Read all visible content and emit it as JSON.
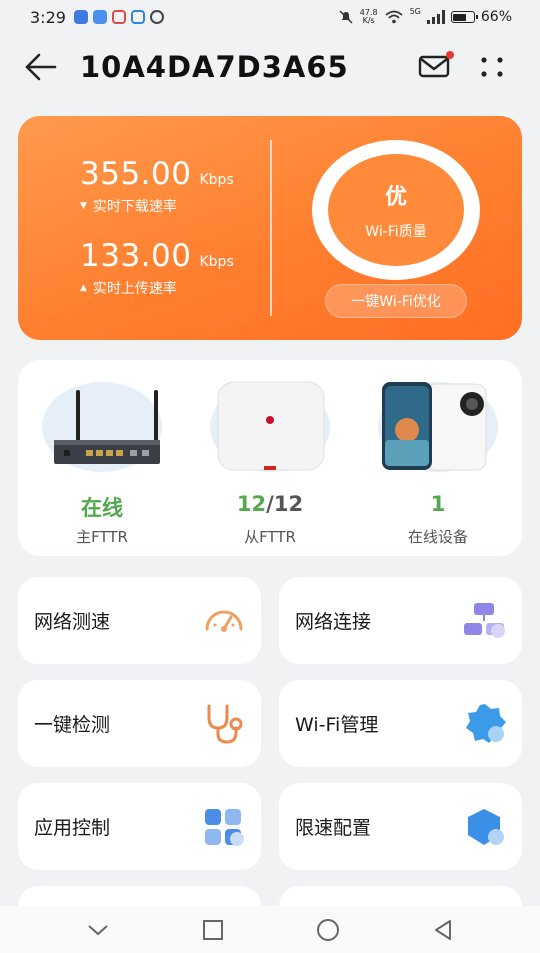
{
  "status_bar": {
    "time": "3:29",
    "net_speed_value": "47.8",
    "net_speed_unit": "K/s",
    "network": "5G",
    "battery": "66%",
    "battery_level": 0.66
  },
  "header": {
    "title": "10A4DA7D3A65"
  },
  "speed_card": {
    "download_value": "355.00",
    "download_unit": "Kbps",
    "download_label": "实时下载速率",
    "upload_value": "133.00",
    "upload_unit": "Kbps",
    "upload_label": "实时上传速率",
    "quality_grade": "优",
    "quality_label": "Wi-Fi质量",
    "optimize_label": "一键Wi-Fi优化",
    "colors": {
      "gradient_start": "#ff9a4d",
      "gradient_end": "#ff6f24"
    }
  },
  "devices": [
    {
      "status": "在线",
      "label": "主FTTR",
      "icon": "router-icon"
    },
    {
      "status_primary": "12",
      "status_rest": "/12",
      "label": "从FTTR",
      "icon": "access-point-icon"
    },
    {
      "status": "1",
      "label": "在线设备",
      "icon": "phone-icon"
    }
  ],
  "tiles": [
    {
      "label": "网络测速",
      "icon": "speedometer-icon"
    },
    {
      "label": "网络连接",
      "icon": "network-topology-icon"
    },
    {
      "label": "一键检测",
      "icon": "stethoscope-icon"
    },
    {
      "label": "Wi-Fi管理",
      "icon": "wifi-settings-icon"
    },
    {
      "label": "应用控制",
      "icon": "app-grid-icon"
    },
    {
      "label": "限速配置",
      "icon": "speed-limit-icon"
    }
  ],
  "accent_colors": {
    "online_green": "#54a84f",
    "orange": "#ff8a3a",
    "notification_red": "#e53935"
  }
}
